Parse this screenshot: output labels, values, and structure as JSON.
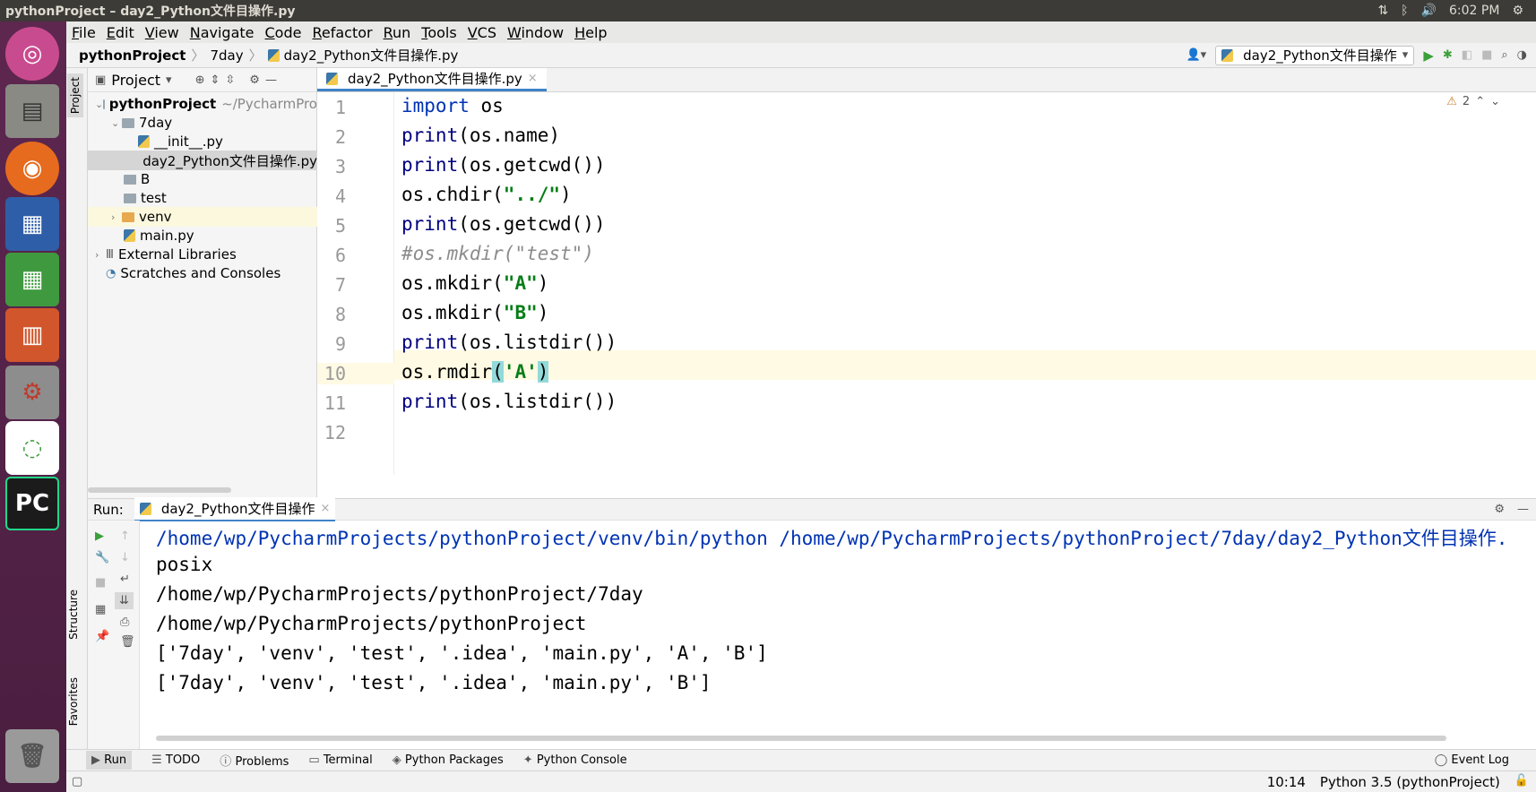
{
  "window": {
    "title": "pythonProject – day2_Python文件目操作.py"
  },
  "system_tray": {
    "time": "6:02 PM"
  },
  "menu": [
    "File",
    "Edit",
    "View",
    "Navigate",
    "Code",
    "Refactor",
    "Run",
    "Tools",
    "VCS",
    "Window",
    "Help"
  ],
  "breadcrumb": [
    "pythonProject",
    "7day",
    "day2_Python文件目操作.py"
  ],
  "run_config": {
    "label": "day2_Python文件目操作"
  },
  "left_tabs": {
    "project": "Project",
    "structure": "Structure",
    "favorites": "Favorites"
  },
  "project_panel": {
    "title": "Project",
    "root": {
      "name": "pythonProject",
      "path": "~/PycharmPro"
    },
    "items": [
      {
        "name": "7day"
      },
      {
        "name": "__init__.py"
      },
      {
        "name": "day2_Python文件目操作.py"
      },
      {
        "name": "B"
      },
      {
        "name": "test"
      },
      {
        "name": "venv"
      },
      {
        "name": "main.py"
      },
      {
        "name": "External Libraries"
      },
      {
        "name": "Scratches and Consoles"
      }
    ]
  },
  "editor": {
    "tab_label": "day2_Python文件目操作.py",
    "warnings": "2",
    "line_numbers": [
      "1",
      "2",
      "3",
      "4",
      "5",
      "6",
      "7",
      "8",
      "9",
      "10",
      "11",
      "12"
    ]
  },
  "run_panel": {
    "label": "Run:",
    "tab": "day2_Python文件目操作",
    "output": [
      "/home/wp/PycharmProjects/pythonProject/venv/bin/python /home/wp/PycharmProjects/pythonProject/7day/day2_Python文件目操作.",
      "posix",
      "/home/wp/PycharmProjects/pythonProject/7day",
      "/home/wp/PycharmProjects/pythonProject",
      "['7day', 'venv', 'test', '.idea', 'main.py', 'A', 'B']",
      "['7day', 'venv', 'test', '.idea', 'main.py', 'B']"
    ]
  },
  "bottom_tabs": [
    "Run",
    "TODO",
    "Problems",
    "Terminal",
    "Python Packages",
    "Python Console"
  ],
  "event_log": "Event Log",
  "status": {
    "position": "10:14",
    "interpreter": "Python 3.5 (pythonProject)"
  },
  "colors": {
    "keyword": "#0033b3",
    "string": "#067d17",
    "comment": "#8c8c8c",
    "launcher": "#5e2750"
  }
}
